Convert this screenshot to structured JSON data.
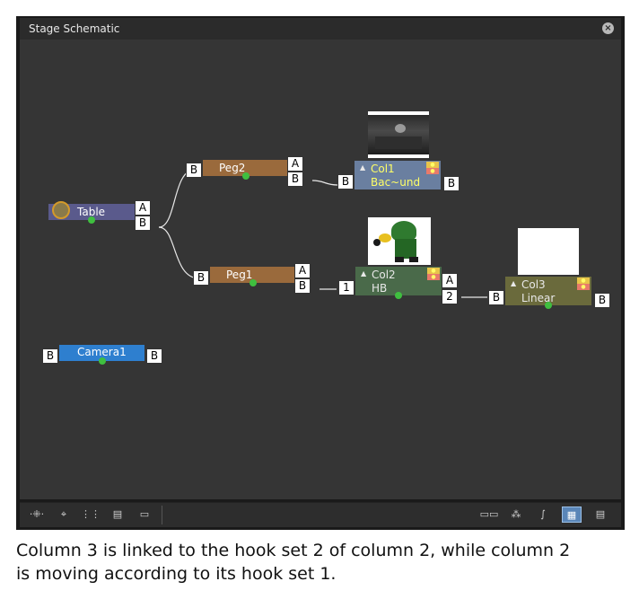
{
  "window": {
    "title": "Stage Schematic"
  },
  "nodes": {
    "table": {
      "label": "Table",
      "ports_right": [
        "A",
        "B"
      ]
    },
    "peg2": {
      "label": "Peg2",
      "port_left": "B",
      "ports_right": [
        "A",
        "B"
      ]
    },
    "peg1": {
      "label": "Peg1",
      "port_left": "B",
      "ports_right": [
        "A",
        "B"
      ]
    },
    "camera1": {
      "label": "Camera1",
      "port_left": "B",
      "port_right": "B"
    },
    "col1": {
      "name": "Col1",
      "sub": "Bac~und",
      "port_left": "B",
      "port_right": "B"
    },
    "col2": {
      "name": "Col2",
      "sub": "HB",
      "port_left": "1",
      "ports_right": [
        "A",
        "2"
      ]
    },
    "col3": {
      "name": "Col3",
      "sub": "Linear",
      "port_left": "B",
      "port_right": "B"
    }
  },
  "colors": {
    "table": "#5a5a8c",
    "peg": "#9a6a3c",
    "camera": "#2e7fcf",
    "col1": "#6a7fa0",
    "col2": "#4a6a4a",
    "col3": "#6a6a3c",
    "dot": "#3fbf3f"
  },
  "toolbar": {
    "left_icons": [
      "fit-to-window-icon",
      "focus-on-current-icon",
      "reorder-nodes-icon",
      "reset-size-icon",
      "preview-toggle-icon"
    ],
    "right_icons": [
      "swap-fx-stage-icon",
      "group-icon",
      "spline-icon",
      "camera-table-view-icon",
      "output-icon"
    ]
  },
  "caption": {
    "line1": "Column 3 is linked to the hook set 2 of column 2, while column 2",
    "line2": "is moving according to its hook set 1."
  }
}
